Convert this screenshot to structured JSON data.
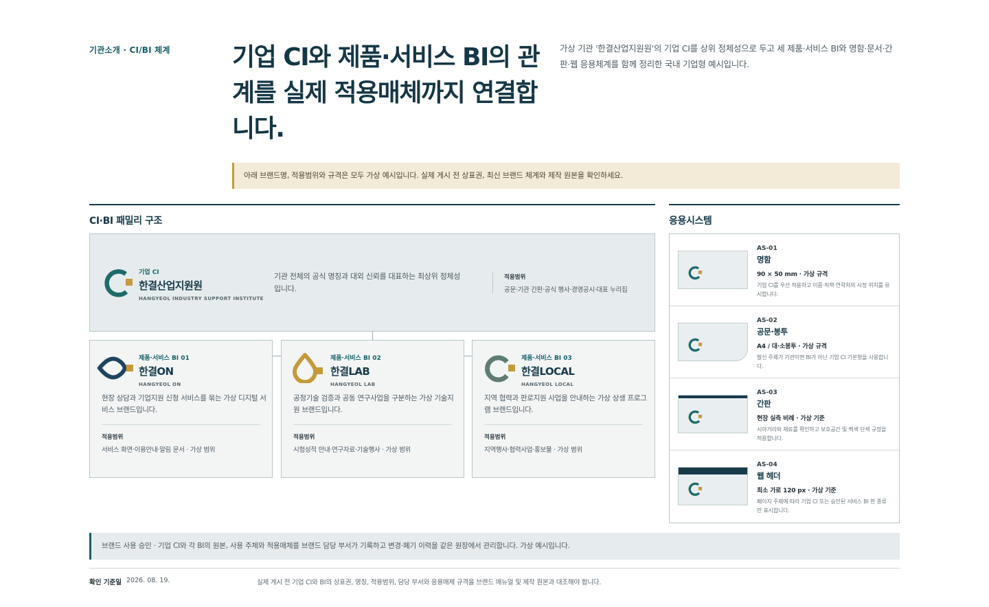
{
  "header": {
    "eyebrow": "기관소개 · CI/BI 체계",
    "headline": "기업 CI와 제품·서비스 BI의 관계를 실제 적용매체까지 연결합니다.",
    "lead": "가상 기관 '한결산업지원원'의 기업 CI를 상위 정체성으로 두고 세 제품·서비스 BI와 명함·문서·간판·웹 응용체계를 함께 정리한 국내 기업형 예시입니다."
  },
  "notice": "아래 브랜드명, 적용범위와 규격은 모두 가상 예시입니다. 실제 게시 전 상표권, 최신 브랜드 체계와 제작 원본을 확인하세요.",
  "family": {
    "title": "CI·BI 패밀리 구조",
    "ci": {
      "kicker": "기업 CI",
      "name": "한결산업지원원",
      "name_en": "HANGYEOL INDUSTRY SUPPORT INSTITUTE",
      "description": "기관 전체의 공식 명칭과 대외 신뢰를 대표하는 최상위 정체성입니다.",
      "scope_label": "적용범위",
      "scope": "공문·기관 간판·공식 행사·경영공시·대표 누리집"
    },
    "bis": [
      {
        "kicker": "제품·서비스 BI 01",
        "name": "한결ON",
        "name_en": "HANGYEOL ON",
        "description": "현장 상담과 기업지원 신청 서비스를 묶는 가상 디지털 서비스 브랜드입니다.",
        "scope_label": "적용범위",
        "scope": "서비스 화면·이용안내·알림 문서 · 가상 범위",
        "color": "#1d4560"
      },
      {
        "kicker": "제품·서비스 BI 02",
        "name": "한결LAB",
        "name_en": "HANGYEOL LAB",
        "description": "공정기술 검증과 공동 연구사업을 구분하는 가상 기술지원 브랜드입니다.",
        "scope_label": "적용범위",
        "scope": "시험성적 안내·연구자료·기술행사 · 가상 범위",
        "color": "#c59a3a"
      },
      {
        "kicker": "제품·서비스 BI 03",
        "name": "한결LOCAL",
        "name_en": "HANGYEOL LOCAL",
        "description": "지역 협력과 판로지원 사업을 안내하는 가상 상생 프로그램 브랜드입니다.",
        "scope_label": "적용범위",
        "scope": "지역행사·협력사업·홍보물 · 가상 범위",
        "color": "#5e7c74"
      }
    ]
  },
  "applications": {
    "title": "응용시스템",
    "items": [
      {
        "code": "AS-01",
        "name": "명함",
        "spec": "90 × 50 mm · 가상 규격",
        "note": "기업 CI를 우선 적용하고 이름·직책·연락처의 시정 위치를 유시합니다."
      },
      {
        "code": "AS-02",
        "name": "공문·봉투",
        "spec": "A4 / 대·소봉투 · 가상 규격",
        "note": "발신 주체가 기관이면 BI가 아닌 기업 CI 기본형을 사용합니다."
      },
      {
        "code": "AS-03",
        "name": "간판",
        "spec": "현장 실측 비례 · 가상 기준",
        "note": "시야거리와 재료를 확인하고 보호공간 및 백색 단색 규정을 적용합니다."
      },
      {
        "code": "AS-04",
        "name": "웹 헤더",
        "spec": "최소 가로 120 px · 가상 기준",
        "note": "페이지 주체에 따라 기업 CI 또는 승인된 서비스 BI 한 종류만 표시합니다."
      }
    ]
  },
  "bottom_note": "브랜드 사용 승인 · 기업 CI와 각 BI의 원본, 사용 주체와 적용매체를 브랜드 담당 부서가 기록하고 변경·폐기 이력을 같은 원장에서 관리합니다. 가상 예시입니다.",
  "footer": {
    "label": "확인 기준일",
    "date": "2026. 08. 19.",
    "text": "실제 게시 전 기업 CI와 BI의 상표권, 명칭, 적용범위, 담당 부서와 응용매체 규격을 브랜드 매뉴얼 및 제작 원본과 대조해야 합니다."
  },
  "colors": {
    "navy": "#173a4a",
    "teal": "#16606a",
    "gold": "#c59a3a",
    "ci_mark": "#1d6b6a"
  },
  "icons": [
    "hangyeol-ci-icon",
    "hangyeol-on-icon",
    "hangyeol-lab-icon",
    "hangyeol-local-icon"
  ]
}
